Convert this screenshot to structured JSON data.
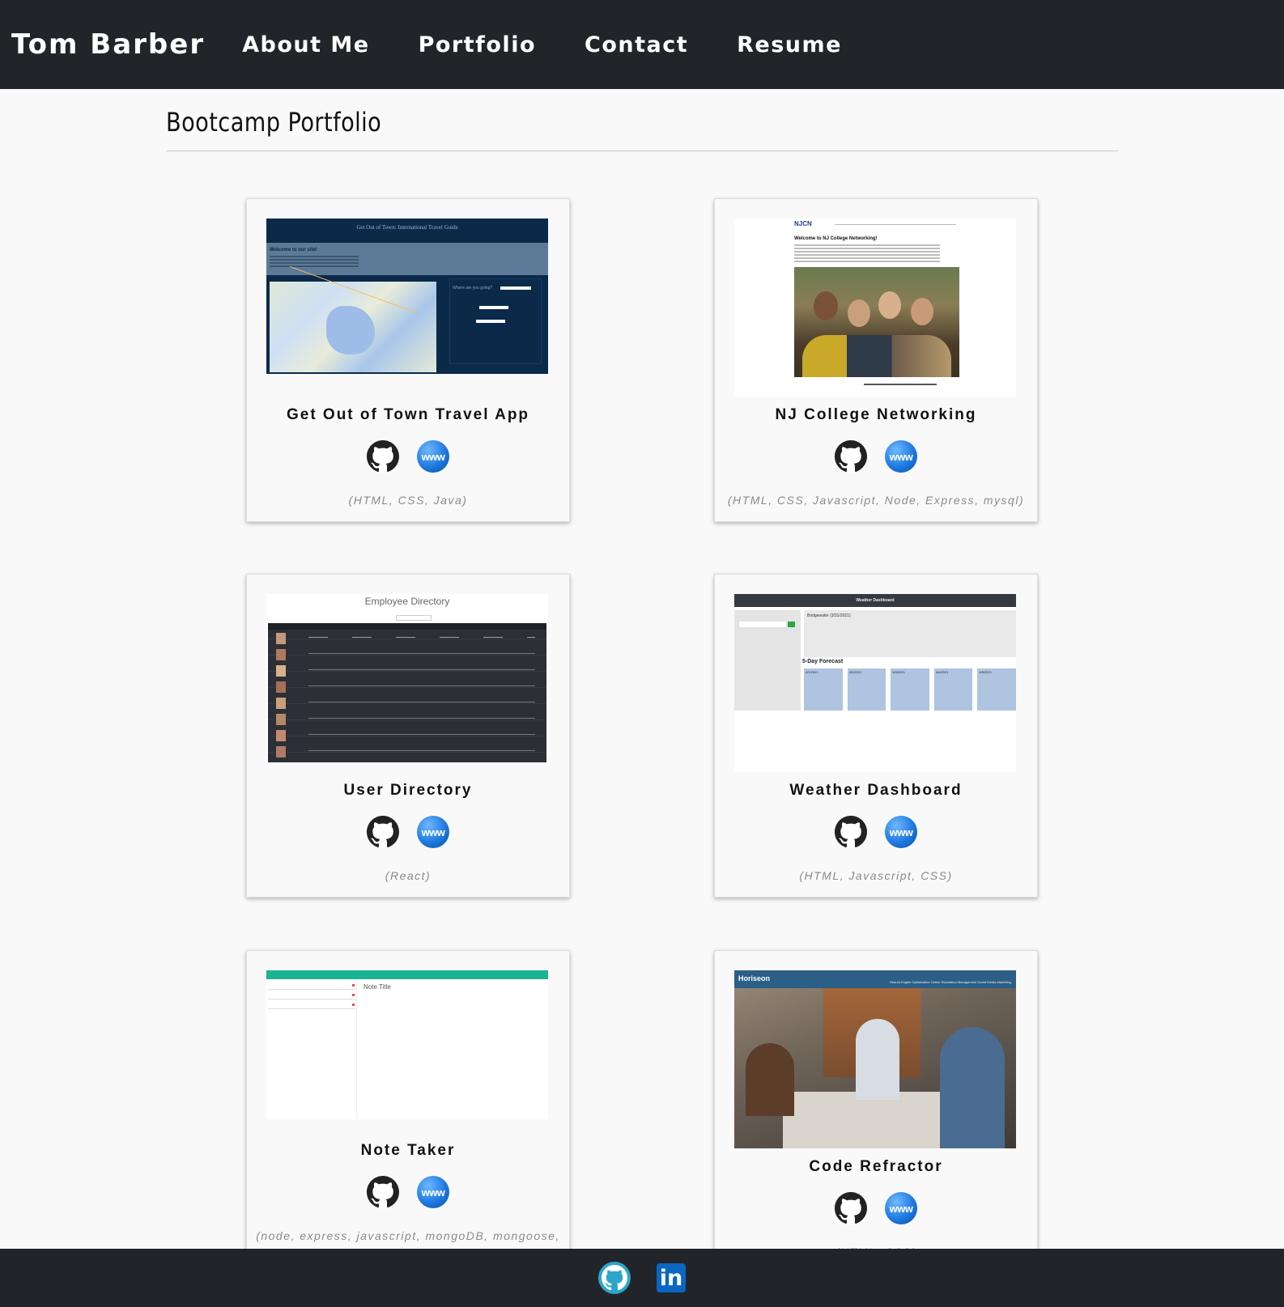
{
  "nav": {
    "brand": "Tom Barber",
    "links": [
      "About Me",
      "Portfolio",
      "Contact",
      "Resume"
    ]
  },
  "page": {
    "title": "Bootcamp Portfolio"
  },
  "projects": [
    {
      "title": "Get Out of Town Travel App",
      "tech": "(HTML, CSS, Java)"
    },
    {
      "title": "NJ College Networking",
      "tech": "(HTML, CSS, Javascript, Node, Express, mysql)"
    },
    {
      "title": "User Directory",
      "tech": "(React)"
    },
    {
      "title": "Weather Dashboard",
      "tech": "(HTML, Javascript, CSS)"
    },
    {
      "title": "Note Taker",
      "tech": "(node, express, javascript, mongoDB, mongoose,"
    },
    {
      "title": "Code Refractor",
      "tech": "(HTML, CSS)"
    }
  ],
  "thumbs": {
    "travel": {
      "heading": "Get Out of Town: International Travel Guide",
      "welcome": "Welcome to our site!",
      "question": "Where are you going?"
    },
    "nj": {
      "logo": "NJCN",
      "heading": "Welcome to NJ College Networking!"
    },
    "directory": {
      "heading": "Employee Directory"
    },
    "weather": {
      "bar": "Weather Dashboard",
      "city": "Bridgewater (3/31/2021)",
      "forecast": "5-Day Forecast",
      "days": [
        "4/1/2021",
        "4/2/2021",
        "4/3/2021",
        "4/4/2021",
        "4/5/2021"
      ]
    },
    "notes": {
      "title": "Note Title"
    },
    "horiseon": {
      "logo": "Horiseon",
      "menu": "Search Engine Optimization  Online Reputation Management  Social Media Marketing"
    }
  },
  "icons": {
    "github": "github-icon",
    "website": "www-icon",
    "linkedin": "linkedin-icon"
  },
  "labels": {
    "www": "www",
    "in": "in"
  },
  "colors": {
    "navbar": "#212529",
    "background": "#f9f9f9",
    "accent_blue": "#1e7ae0",
    "teal": "#2ba6c9"
  }
}
